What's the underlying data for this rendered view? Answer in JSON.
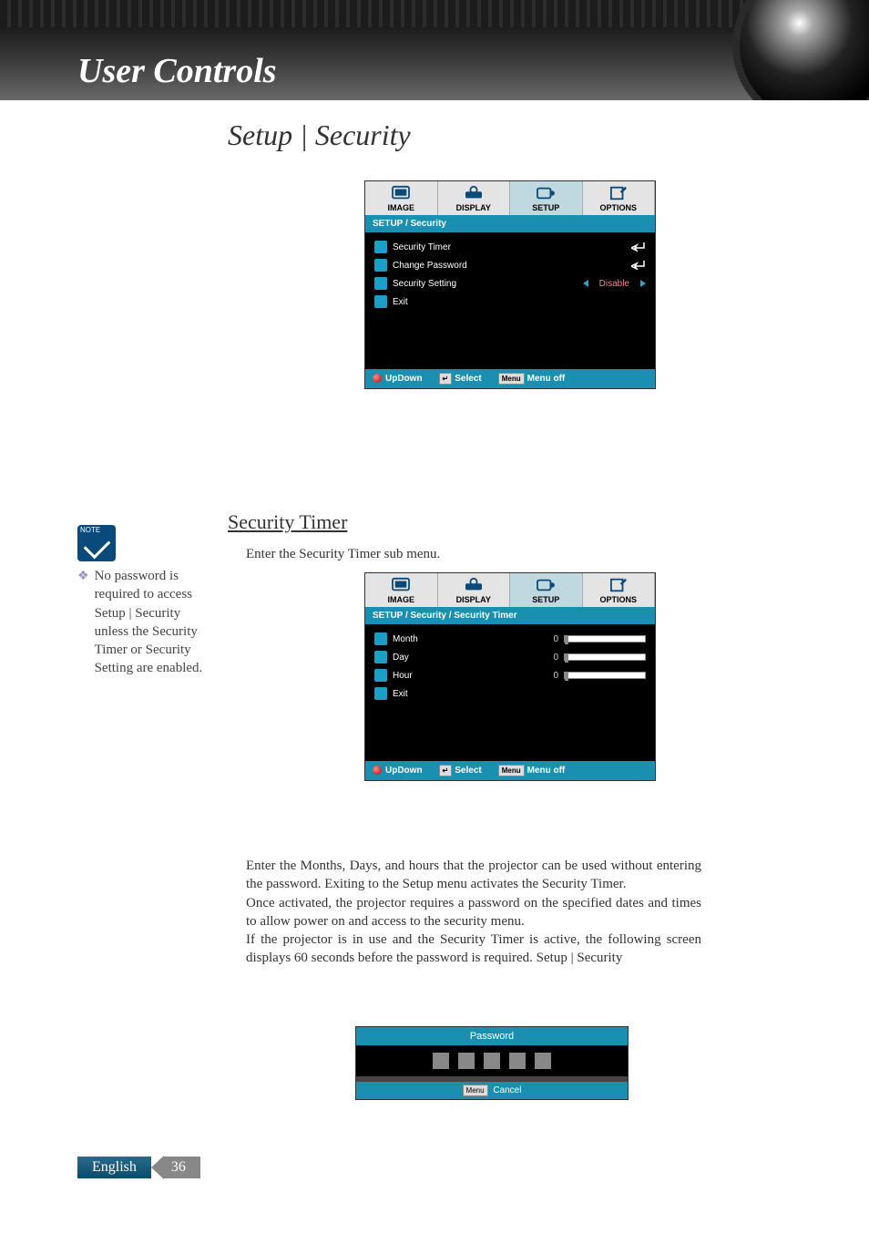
{
  "banner": {
    "title": "User Controls"
  },
  "section": {
    "title": "Setup | Security"
  },
  "osd_tabs": {
    "image": "IMAGE",
    "display": "DISPLAY",
    "setup": "SETUP",
    "options": "OPTIONS"
  },
  "osd1": {
    "breadcrumb": "SETUP / Security",
    "rows": {
      "security_timer": "Security Timer",
      "change_password": "Change Password",
      "security_setting": "Security Setting",
      "security_setting_value": "Disable",
      "exit": "Exit"
    }
  },
  "osd2": {
    "breadcrumb": "SETUP / Security / Security Timer",
    "rows": {
      "month": "Month",
      "month_val": "0",
      "day": "Day",
      "day_val": "0",
      "hour": "Hour",
      "hour_val": "0",
      "exit": "Exit"
    }
  },
  "osd_footer": {
    "updown": "UpDown",
    "select": "Select",
    "menu_key": "Menu",
    "menuoff": "Menu off"
  },
  "sub_heading": "Security Timer",
  "body": {
    "p1": "Enter the Security Timer sub menu.",
    "p2": "Enter the Months, Days, and hours that the projector can be used without entering the password. Exiting to the Setup menu activates the Security Timer.",
    "p3": "Once activated, the projector requires a password on the specified dates and times to allow power on and access to the security menu.",
    "p4": "If the projector is in use and the Security Timer is active, the following screen displays 60 seconds before the password is required. Setup | Security"
  },
  "note": {
    "label": "NOTE",
    "text": "No password is required to access Setup | Security unless the Security Timer or Security Setting are enabled."
  },
  "password": {
    "title": "Password",
    "menu_key": "Menu",
    "cancel": "Cancel"
  },
  "footer": {
    "language": "English",
    "page": "36"
  }
}
